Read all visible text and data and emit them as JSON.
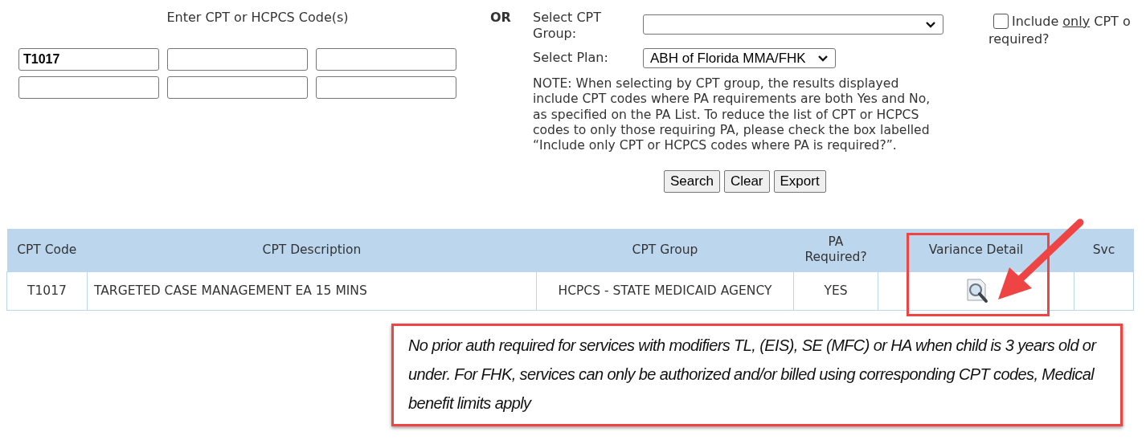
{
  "code_entry": {
    "title": "Enter CPT or HCPCS Code(s)",
    "fields": [
      {
        "value": "T1017"
      }
    ]
  },
  "or_label": "OR",
  "group_select": {
    "label": "Select CPT Group:"
  },
  "plan_select": {
    "label": "Select Plan:",
    "value": "ABH of Florida MMA/FHK"
  },
  "note": "NOTE: When selecting by CPT group, the results displayed include CPT codes where PA requirements are both Yes and No, as specified on the PA List. To reduce the list of CPT or HCPCS codes to only those requiring PA, please check the box labelled “Include only CPT or HCPCS codes where PA is required?”.",
  "include_only": {
    "checked": false,
    "label_start": "Include ",
    "label_underlined": "only",
    "label_end": " CPT o",
    "label_line2": "required?"
  },
  "buttons": [
    "Search",
    "Clear",
    "Export"
  ],
  "table": {
    "columns": [
      "CPT Code",
      "CPT Description",
      "CPT Group",
      "PA Required?",
      "Variance Detail",
      "Svc"
    ],
    "rows": [
      {
        "cells": [
          "T1017",
          "TARGETED CASE MANAGEMENT EA 15 MINS",
          "HCPCS - STATE MEDICAID AGENCY",
          "YES",
          "",
          ""
        ],
        "variance_icon": true
      }
    ]
  },
  "callout": "No prior auth required for services with modifiers TL, (EIS), SE (MFC) or HA when child is 3 years old or under. For FHK, services can only be authorized and/or billed using corresponding CPT codes, Medical benefit limits apply"
}
